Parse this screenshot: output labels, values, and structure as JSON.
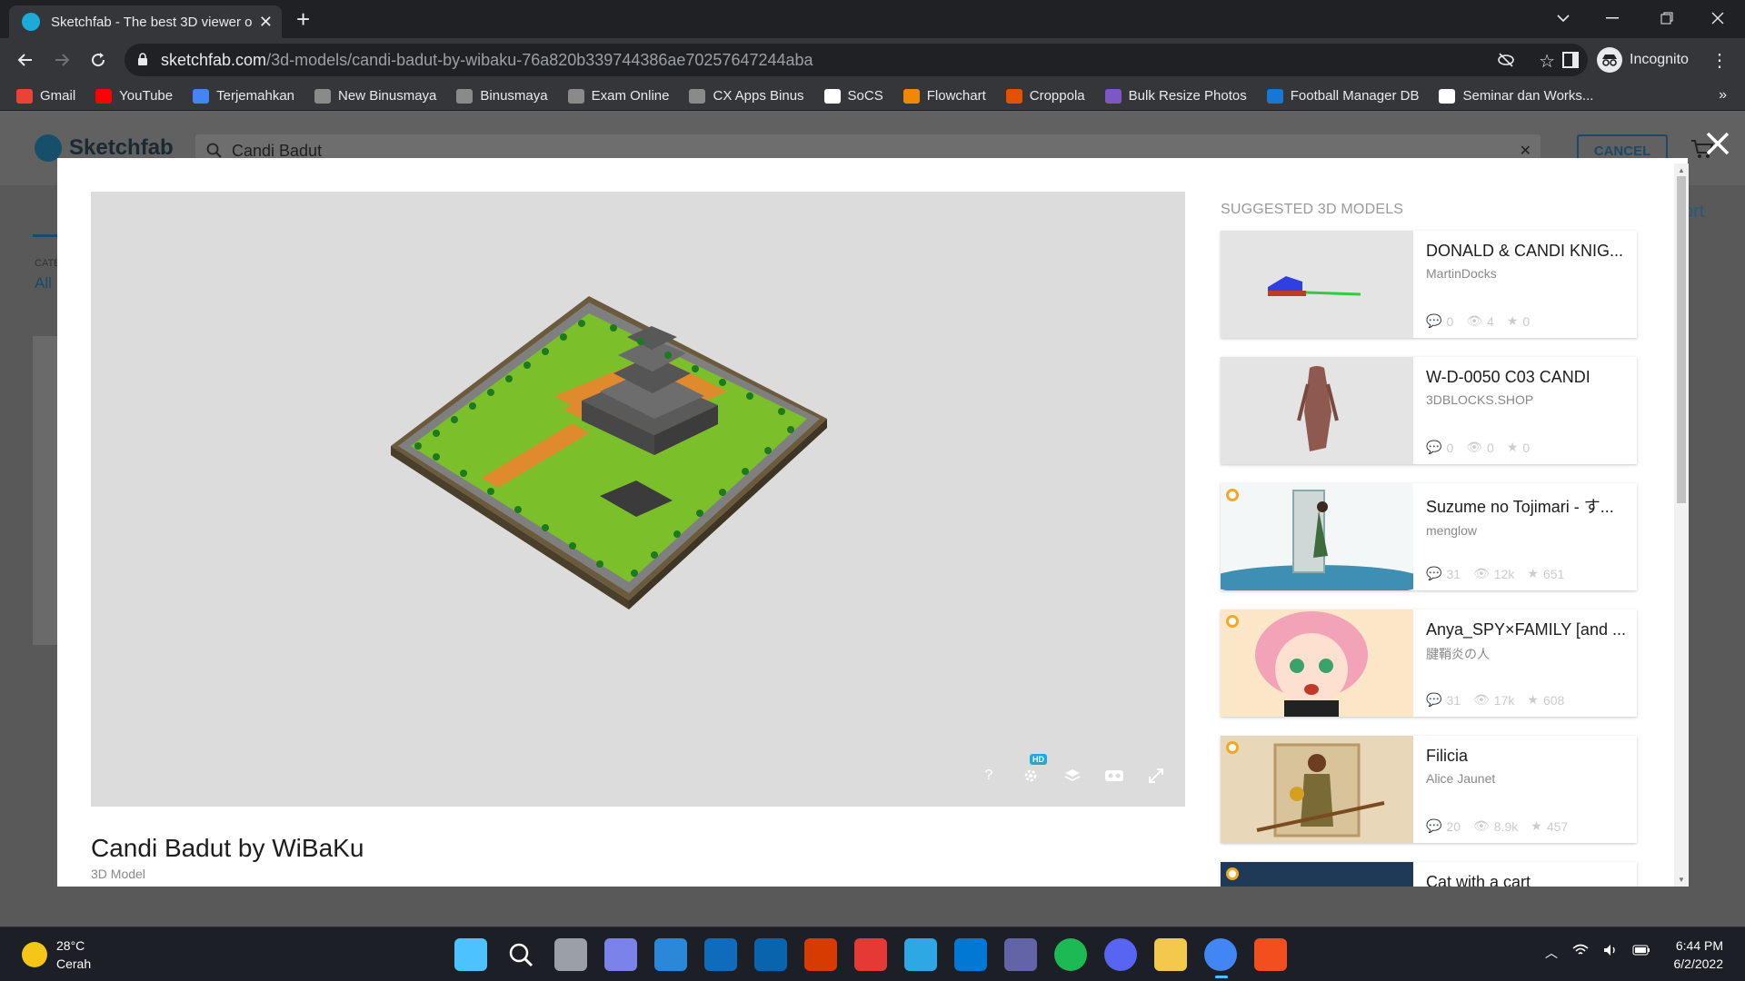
{
  "browser": {
    "tab_title": "Sketchfab - The best 3D viewer o",
    "url_domain": "sketchfab.com",
    "url_path": "/3d-models/candi-badut-by-wibaku-76a820b339744386ae70257647244aba",
    "profile_label": "Incognito"
  },
  "bookmarks": [
    {
      "label": "Gmail",
      "color": "#ea4335"
    },
    {
      "label": "YouTube",
      "color": "#ff0000"
    },
    {
      "label": "Terjemahkan",
      "color": "#4285f4"
    },
    {
      "label": "New Binusmaya",
      "color": "#8a8a8a"
    },
    {
      "label": "Binusmaya",
      "color": "#8a8a8a"
    },
    {
      "label": "Exam Online",
      "color": "#8a8a8a"
    },
    {
      "label": "CX Apps Binus",
      "color": "#8a8a8a"
    },
    {
      "label": "SoCS",
      "color": "#ffffff"
    },
    {
      "label": "Flowchart",
      "color": "#f08705"
    },
    {
      "label": "Croppola",
      "color": "#e65100"
    },
    {
      "label": "Bulk Resize Photos",
      "color": "#7e57c2"
    },
    {
      "label": "Football Manager DB",
      "color": "#1976d2"
    },
    {
      "label": "Seminar dan Works...",
      "color": "#ffffff"
    }
  ],
  "sketchfab": {
    "logo_text": "Sketchfab",
    "search_value": "Candi Badut",
    "cancel_label": "CANCEL",
    "bg_category_label": "CATE",
    "bg_category_value": "All",
    "bg_sort_fragment": "ort"
  },
  "model": {
    "title": "Candi Badut by WiBaKu",
    "subtitle": "3D Model",
    "hd_badge": "HD",
    "help_glyph": "?"
  },
  "suggested": {
    "heading": "SUGGESTED 3D MODELS",
    "items": [
      {
        "name": "DONALD & CANDI KNIG...",
        "author": "MartinDocks",
        "comments": "0",
        "views": "4",
        "likes": "0",
        "staff_pick": false
      },
      {
        "name": "W-D-0050 C03 CANDI",
        "author": "3DBLOCKS.SHOP",
        "comments": "0",
        "views": "0",
        "likes": "0",
        "staff_pick": false
      },
      {
        "name": "Suzume no Tojimari - す...",
        "author": "menglow",
        "comments": "31",
        "views": "12k",
        "likes": "651",
        "staff_pick": true
      },
      {
        "name": "Anya_SPY×FAMILY [and ...",
        "author": "腱鞘炎の人",
        "comments": "31",
        "views": "17k",
        "likes": "608",
        "staff_pick": true
      },
      {
        "name": "Filicia",
        "author": "Alice Jaunet",
        "comments": "20",
        "views": "8.9k",
        "likes": "457",
        "staff_pick": true
      },
      {
        "name": "Cat with a cart",
        "author": "",
        "comments": "",
        "views": "",
        "likes": "",
        "staff_pick": true
      }
    ]
  },
  "taskbar": {
    "temperature": "28°C",
    "weather": "Cerah",
    "time": "6:44 PM",
    "date": "6/2/2022",
    "apps": [
      {
        "name": "windows-start",
        "color": "#4cc2ff"
      },
      {
        "name": "search",
        "color": "#1c1f26"
      },
      {
        "name": "task-view",
        "color": "#9aa0a6"
      },
      {
        "name": "teams-chat",
        "color": "#7b83eb"
      },
      {
        "name": "widgets",
        "color": "#2b88d8"
      },
      {
        "name": "mail",
        "color": "#0f6cbd"
      },
      {
        "name": "outlook",
        "color": "#0a64ad"
      },
      {
        "name": "office",
        "color": "#d83b01"
      },
      {
        "name": "wps",
        "color": "#e53935"
      },
      {
        "name": "lupa",
        "color": "#2ea8e5"
      },
      {
        "name": "vscode",
        "color": "#0078d4"
      },
      {
        "name": "dev-app",
        "color": "#6264a7"
      },
      {
        "name": "spotify",
        "color": "#1db954"
      },
      {
        "name": "discord",
        "color": "#5865f2"
      },
      {
        "name": "file-explorer",
        "color": "#f2c94c"
      },
      {
        "name": "chrome",
        "color": "#4285f4"
      },
      {
        "name": "figma",
        "color": "#f24e1e"
      }
    ]
  }
}
